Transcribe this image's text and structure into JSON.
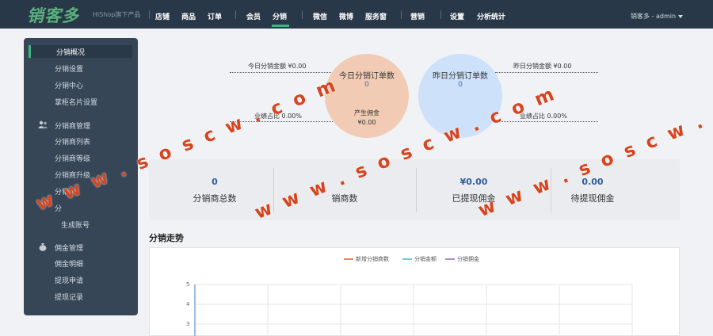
{
  "app": {
    "logo": "销客多",
    "logo_sub": "HiShop旗下产品",
    "accent": "#40b67e",
    "topbar_bg": "#283848"
  },
  "nav": {
    "items": [
      {
        "label": "店铺"
      },
      {
        "label": "商品"
      },
      {
        "label": "订单"
      },
      {
        "label": "会员"
      },
      {
        "label": "分销"
      },
      {
        "label": "微信"
      },
      {
        "label": "微博"
      },
      {
        "label": "服务窗"
      },
      {
        "label": "营销"
      },
      {
        "label": "设置"
      },
      {
        "label": "分析统计"
      }
    ],
    "active": "分销",
    "user": "销客多 - admin"
  },
  "sidebar": {
    "items": [
      {
        "label": "分销概况"
      },
      {
        "label": "分销设置"
      },
      {
        "label": "分销中心"
      },
      {
        "label": "掌柜名片设置"
      }
    ],
    "groups": [
      {
        "title": "分销商管理",
        "icon": "users-icon",
        "items": [
          {
            "label": "分销商列表"
          },
          {
            "label": "分销商等级"
          },
          {
            "label": "分销商升级"
          },
          {
            "label": "分销"
          },
          {
            "label": "分"
          },
          {
            "label": "生成账号"
          }
        ]
      },
      {
        "title": "佣金管理",
        "icon": "money-bag-icon",
        "items": [
          {
            "label": "佣金明细"
          },
          {
            "label": "提现申请"
          },
          {
            "label": "提现记录"
          }
        ]
      }
    ]
  },
  "overview": {
    "today": {
      "circle_title": "今日分销订单数",
      "circle_value": "0",
      "commission_label": "产生佣金",
      "commission_value": "¥0.00",
      "amount_label": "今日分销金额 ¥0.00",
      "ratio_label": "业绩占比 0.00%"
    },
    "yesterday": {
      "circle_title": "昨日分销订单数",
      "circle_value": "0",
      "amount_label": "昨日分销金额 ¥0.00",
      "ratio_label": "业绩占比 0.00%"
    },
    "colors": {
      "today_circle": "#f2cbb4",
      "yesterday_circle": "#cde1fb"
    }
  },
  "stats": [
    {
      "value": "0",
      "label": "分销商总数"
    },
    {
      "value": "",
      "label": "销商数"
    },
    {
      "value": "¥0.00",
      "label": "已提现佣金"
    },
    {
      "value": "0.00",
      "label": "待提现佣金"
    }
  ],
  "trend": {
    "title": "分销走势"
  },
  "chart_data": {
    "type": "line",
    "title": "",
    "series": [
      {
        "name": "新增分销商数",
        "color": "#e8855c",
        "values": []
      },
      {
        "name": "分销金额",
        "color": "#7cc1e8",
        "values": []
      },
      {
        "name": "分销佣金",
        "color": "#b58ad9",
        "values": []
      }
    ],
    "y_ticks": [
      "5",
      "4",
      "3"
    ],
    "grid": true,
    "legend_position": "top-center"
  },
  "watermark": {
    "text": "w w w . s o s c w . c o m",
    "color": "#d8441e"
  }
}
